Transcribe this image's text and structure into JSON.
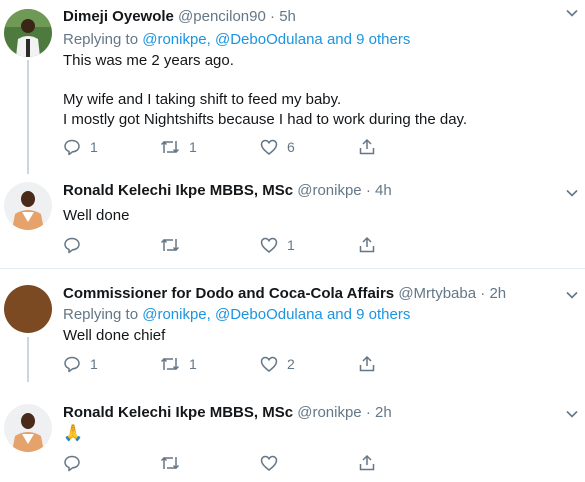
{
  "tweets": [
    {
      "name": "Dimeji Oyewole",
      "handle": "@pencilon90",
      "time": "5h",
      "replying_prefix": "Replying to",
      "replying_to": "@ronikpe, @DeboOdulana and 9 others",
      "text_line1": "This was me 2 years ago.",
      "text_line2": "My wife and I taking shift to feed my baby.",
      "text_line3": "I mostly got Nightshifts because I had to work during the day.",
      "replies": "1",
      "retweets": "1",
      "likes": "6"
    },
    {
      "name": "Ronald Kelechi Ikpe MBBS, MSc",
      "handle": "@ronikpe",
      "time": "4h",
      "text": "Well done",
      "replies": "",
      "retweets": "",
      "likes": "1"
    },
    {
      "name": "Commissioner for Dodo and Coca-Cola Affairs",
      "handle": "@Mrtybaba",
      "time": "2h",
      "replying_prefix": "Replying to",
      "replying_to": "@ronikpe, @DeboOdulana and 9 others",
      "text": "Well done chief",
      "replies": "1",
      "retweets": "1",
      "likes": "2"
    },
    {
      "name": "Ronald Kelechi Ikpe MBBS, MSc",
      "handle": "@ronikpe",
      "time": "2h",
      "text": "🙏",
      "replies": "",
      "retweets": "",
      "likes": ""
    }
  ],
  "separator": "·",
  "icons": {
    "reply": "reply-icon",
    "retweet": "retweet-icon",
    "like": "heart-icon",
    "share": "share-icon",
    "more": "chevron-down-icon"
  },
  "colors": {
    "name": "#14171a",
    "secondary": "#657786",
    "link": "#1b95e0",
    "thread_line": "#ccd6dd",
    "divider": "#e6ecf0",
    "avatar_brown": "#7b4a22"
  }
}
